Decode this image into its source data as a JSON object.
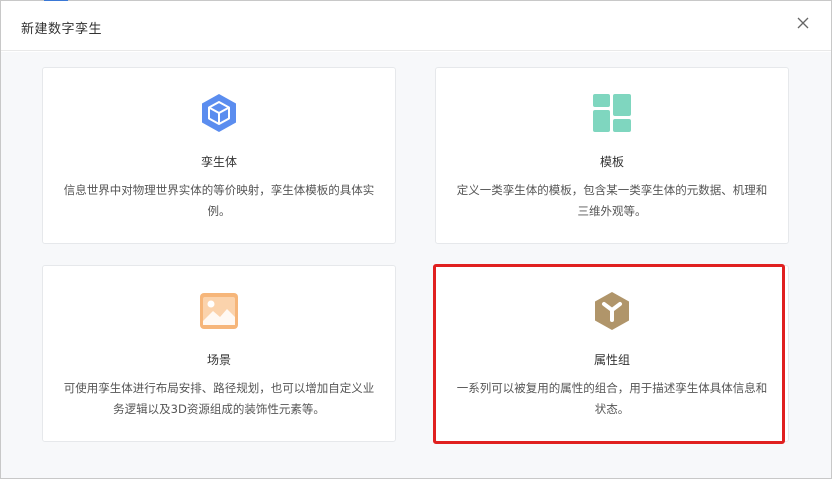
{
  "dialog": {
    "title": "新建数字孪生",
    "close_icon": "close-icon"
  },
  "cards": [
    {
      "id": "twin",
      "name": "孪生体",
      "desc": "信息世界中对物理世界实体的等价映射，孪生体模板的具体实例。",
      "icon": "cube-icon",
      "color": "#5b8def"
    },
    {
      "id": "template",
      "name": "模板",
      "desc": "定义一类孪生体的模板，包含某一类孪生体的元数据、机理和三维外观等。",
      "icon": "grid-icon",
      "color": "#7fd6bf"
    },
    {
      "id": "scene",
      "name": "场景",
      "desc": "可使用孪生体进行布局安排、路径规划，也可以增加自定义业务逻辑以及3D资源组成的装饰性元素等。",
      "icon": "image-icon",
      "color": "#f6b67a"
    },
    {
      "id": "attribute-group",
      "name": "属性组",
      "desc": "一系列可以被复用的属性的组合，用于描述孪生体具体信息和状态。",
      "icon": "hexagon-y-icon",
      "color": "#b0956a"
    }
  ],
  "colors": {
    "highlight": "#e02020"
  }
}
